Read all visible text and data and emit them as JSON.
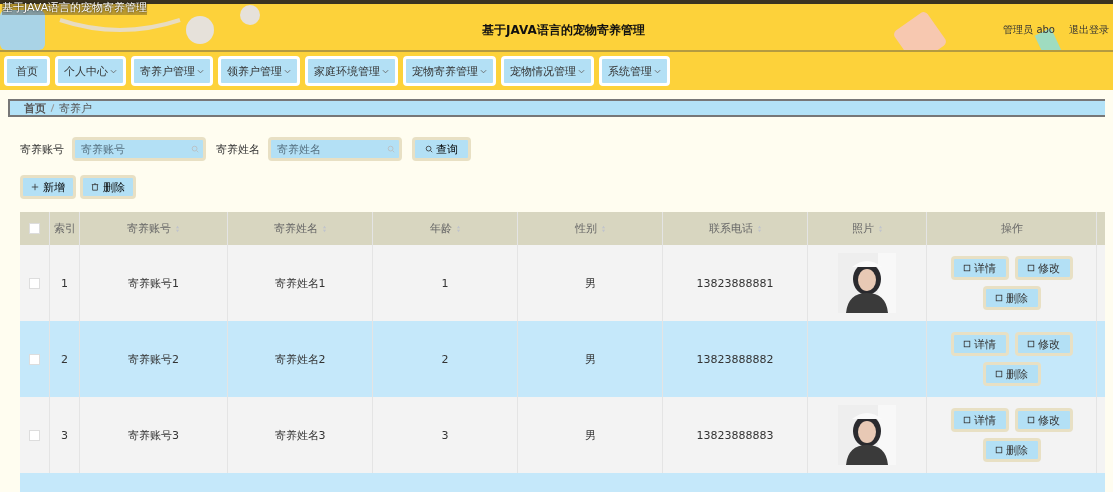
{
  "window": {
    "title": "基于JAVA语言的宠物寄养管理"
  },
  "header": {
    "title": "基于JAVA语言的宠物寄养管理",
    "user": "管理员 abo",
    "logout": "退出登录"
  },
  "nav": [
    {
      "label": "首页",
      "dropdown": false
    },
    {
      "label": "个人中心",
      "dropdown": true
    },
    {
      "label": "寄养户管理",
      "dropdown": true
    },
    {
      "label": "领养户管理",
      "dropdown": true
    },
    {
      "label": "家庭环境管理",
      "dropdown": true
    },
    {
      "label": "宠物寄养管理",
      "dropdown": true
    },
    {
      "label": "宠物情况管理",
      "dropdown": true
    },
    {
      "label": "系统管理",
      "dropdown": true
    }
  ],
  "breadcrumb": [
    "首页",
    "寄养户"
  ],
  "search": {
    "fields": [
      {
        "label": "寄养账号",
        "placeholder": "寄养账号"
      },
      {
        "label": "寄养姓名",
        "placeholder": "寄养姓名"
      }
    ],
    "button": "查询"
  },
  "actions": [
    {
      "kind": "add",
      "label": "新增"
    },
    {
      "kind": "delete",
      "label": "删除"
    }
  ],
  "table": {
    "columns": [
      {
        "label": "索引",
        "sortable": false
      },
      {
        "label": "寄养账号",
        "sortable": true
      },
      {
        "label": "寄养姓名",
        "sortable": true
      },
      {
        "label": "年龄",
        "sortable": true
      },
      {
        "label": "性别",
        "sortable": true
      },
      {
        "label": "联系电话",
        "sortable": true
      },
      {
        "label": "照片",
        "sortable": true
      },
      {
        "label": "操作",
        "sortable": false
      }
    ],
    "header_checked": false,
    "rows": [
      {
        "checked": false,
        "cells": [
          "1",
          "寄养账号1",
          "寄养姓名1",
          "1",
          "男",
          "13823888881"
        ],
        "buttons": [
          "详情",
          "修改",
          "删除"
        ]
      },
      {
        "checked": false,
        "cells": [
          "2",
          "寄养账号2",
          "寄养姓名2",
          "2",
          "男",
          "13823888882"
        ],
        "buttons": [
          "详情",
          "修改",
          "删除"
        ]
      },
      {
        "checked": false,
        "cells": [
          "3",
          "寄养账号3",
          "寄养姓名3",
          "3",
          "男",
          "13823888883"
        ],
        "buttons": [
          "详情",
          "修改",
          "删除"
        ]
      }
    ]
  }
}
